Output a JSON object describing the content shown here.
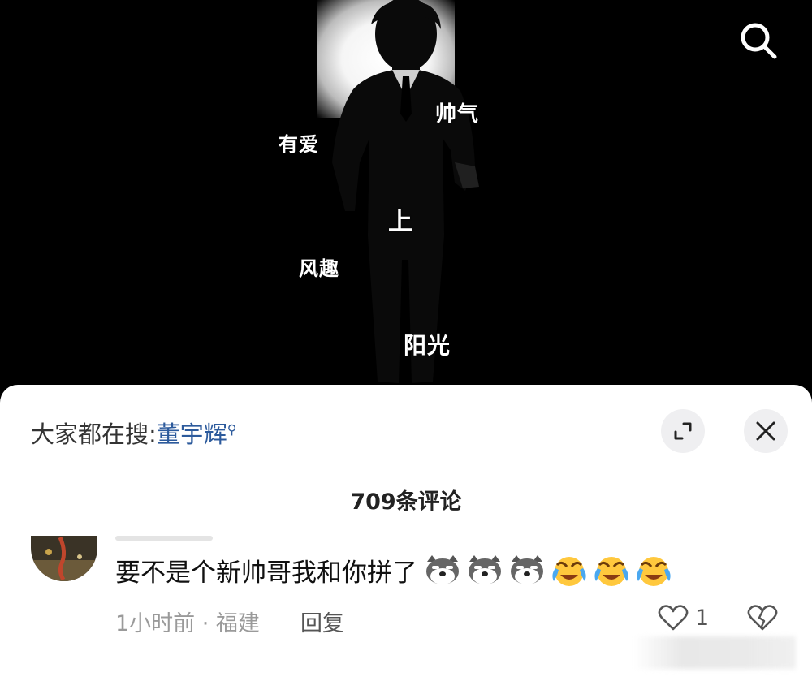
{
  "video": {
    "tags": [
      "帅气",
      "有爱",
      "上",
      "风趣",
      "阳光"
    ],
    "icons": {
      "search": "search-icon"
    }
  },
  "sheet": {
    "hot_search_prefix": "大家都在搜:",
    "hot_search_term": "董宇辉",
    "comment_count": "709条评论",
    "icons": {
      "expand": "expand-icon",
      "close": "close-icon"
    }
  },
  "comment": {
    "text": "要不是个新帅哥我和你拼了",
    "emojis": [
      "doge-icon",
      "doge-icon",
      "doge-icon",
      "laugh-cry-icon",
      "laugh-cry-icon",
      "laugh-cry-icon"
    ],
    "time_location": "1小时前 · 福建",
    "reply_label": "回复",
    "like_count": "1",
    "icons": {
      "like": "heart-icon",
      "dislike": "broken-heart-icon"
    }
  },
  "colors": {
    "link": "#2c5a9c",
    "button_bg": "#efeff1"
  }
}
